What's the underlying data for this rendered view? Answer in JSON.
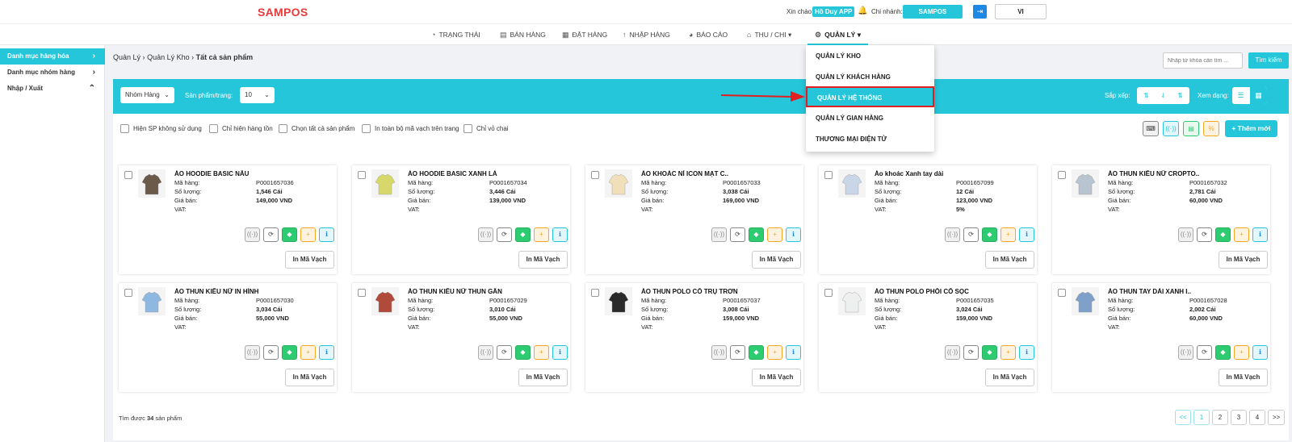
{
  "header": {
    "logo": "SAMPOS",
    "greeting": "Xin chào",
    "user": "Hồ Duy APP",
    "branch_label": "Chi nhánh:",
    "branch": "SAMPOS",
    "lang": "VI"
  },
  "nav": [
    {
      "label": "TRẠNG THÁI",
      "icon": "dashboard-icon",
      "glyph": "◔"
    },
    {
      "label": "BÁN HÀNG",
      "icon": "cart-icon",
      "glyph": "🛒"
    },
    {
      "label": "ĐẶT HÀNG",
      "icon": "calendar-icon",
      "glyph": "▦"
    },
    {
      "label": "NHẬP HÀNG",
      "icon": "import-icon",
      "glyph": "↑"
    },
    {
      "label": "BÁO CÁO",
      "icon": "pie-chart-icon",
      "glyph": "◕"
    },
    {
      "label": "THU / CHI",
      "icon": "bank-icon",
      "glyph": "⌂"
    },
    {
      "label": "QUẢN LÝ",
      "icon": "gear-icon",
      "glyph": "⚙"
    }
  ],
  "sidebar": {
    "items": [
      {
        "label": "Danh mục hàng hóa",
        "chev": "›"
      },
      {
        "label": "Danh mục nhóm hàng",
        "chev": "›"
      },
      {
        "label": "Nhập / Xuất",
        "chev": "⌃"
      }
    ]
  },
  "breadcrumb": {
    "a": "Quản Lý",
    "b": "Quản Lý Kho",
    "c": "Tất cả sản phẩm",
    "sep": "›"
  },
  "search": {
    "placeholder": "Nhập từ khóa cần tìm ...",
    "button": "Tìm kiếm"
  },
  "toolbar": {
    "group": "Nhóm Hàng",
    "perpage_label": "Sản phẩm/trang:",
    "perpage": "10",
    "sort_label": "Sắp xếp:",
    "view_label": "Xem dạng:"
  },
  "filters": [
    "Hiện SP không sử dụng",
    "Chỉ hiện hàng tồn",
    "Chọn tất cả sản phẩm",
    "In toàn bộ mã vạch trên trang",
    "Chỉ vỏ chai"
  ],
  "add_button": "+ Thêm mới",
  "labels": {
    "code": "Mã hàng:",
    "qty": "Số lượng:",
    "price": "Giá bán:",
    "vat": "VAT:",
    "barcode": "In Mã Vạch"
  },
  "products": [
    {
      "name": "ÁO HOODIE BASIC NÂU",
      "code": "P0001657036",
      "qty": "1,546 Cái",
      "price": "149,000 VND",
      "vat": "",
      "color": "#6b5a4a"
    },
    {
      "name": "ÁO HOODIE BASIC XANH LÁ",
      "code": "P0001657034",
      "qty": "3,446 Cái",
      "price": "139,000 VND",
      "vat": "",
      "color": "#d6d96a"
    },
    {
      "name": "ÁO KHOÁC NỈ ICON MẠT C..",
      "code": "P0001657033",
      "qty": "3,038 Cái",
      "price": "169,000 VND",
      "vat": "",
      "color": "#f0dfb8"
    },
    {
      "name": "Áo khoác Xanh tay dài",
      "code": "P0001657099",
      "qty": "12 Cái",
      "price": "123,000 VND",
      "vat": "5%",
      "color": "#c8d6e8"
    },
    {
      "name": "ÁO THUN KIỂU NỮ CROPTO..",
      "code": "P0001657032",
      "qty": "2,781 Cái",
      "price": "60,000 VND",
      "vat": "",
      "color": "#b8c4d0"
    },
    {
      "name": "ÁO THUN KIỂU NỮ IN HÌNH",
      "code": "P0001657030",
      "qty": "3,034 Cái",
      "price": "55,000 VND",
      "vat": "",
      "color": "#8fb8e0"
    },
    {
      "name": "ÁO THUN KIỂU NỮ THUN GÂN",
      "code": "P0001657029",
      "qty": "3,010 Cái",
      "price": "55,000 VND",
      "vat": "",
      "color": "#b04a3a"
    },
    {
      "name": "ÁO THUN POLO CỔ TRỤ TRƠN",
      "code": "P0001657037",
      "qty": "3,008 Cái",
      "price": "159,000 VND",
      "vat": "",
      "color": "#2a2a2a"
    },
    {
      "name": "ÁO THUN POLO PHỐI CỔ SỌC",
      "code": "P0001657035",
      "qty": "3,024 Cái",
      "price": "159,000 VND",
      "vat": "",
      "color": "#eef0f0"
    },
    {
      "name": "ÁO THUN TAY DÀI XANH I..",
      "code": "P0001657028",
      "qty": "2,002 Cái",
      "price": "60,000 VND",
      "vat": "",
      "color": "#7fa0c8"
    }
  ],
  "footer": {
    "result_prefix": "Tìm được",
    "result_count": "34",
    "result_suffix": "sản phẩm",
    "pages": [
      "<<",
      "1",
      "2",
      "3",
      "4",
      ">>"
    ]
  },
  "dropdown": [
    "QUẢN LÝ KHO",
    "QUẢN LÝ KHÁCH HÀNG",
    "QUẢN LÝ HỆ THỐNG",
    "QUẢN LÝ GIAN HÀNG",
    "THƯƠNG MẠI ĐIỆN TỬ"
  ],
  "colors": {
    "accent": "#26c6da",
    "brand": "#e8393b",
    "highlight": "#e02020"
  }
}
